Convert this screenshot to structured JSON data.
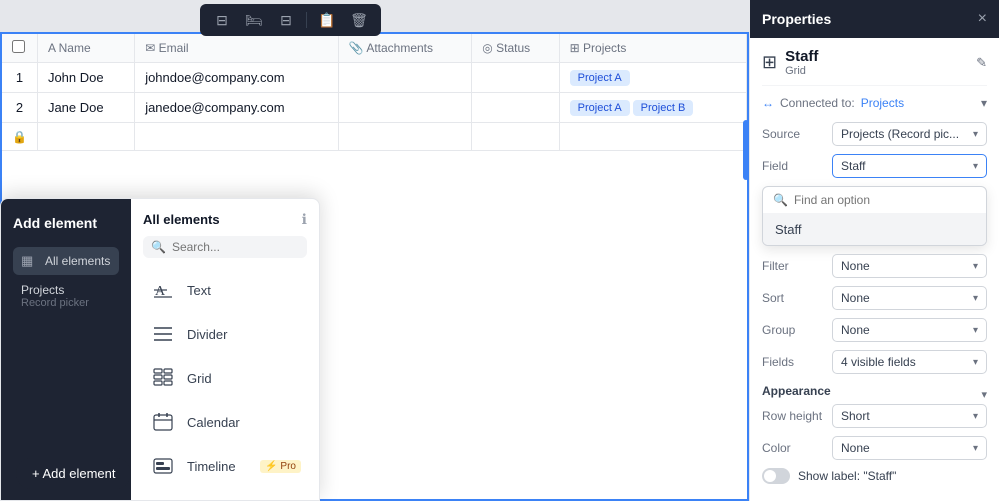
{
  "toolbar": {
    "icons": [
      "⊟",
      "⊞",
      "⊟",
      "📋",
      "🗑"
    ]
  },
  "table": {
    "columns": [
      {
        "label": "Name",
        "icon": "A"
      },
      {
        "label": "Email",
        "icon": "✉"
      },
      {
        "label": "Attachments",
        "icon": "📎"
      },
      {
        "label": "Status",
        "icon": "◎"
      },
      {
        "label": "Projects",
        "icon": "⊞"
      }
    ],
    "rows": [
      {
        "num": "1",
        "name": "John Doe",
        "email": "johndoe@company.com",
        "attachments": "",
        "status": "",
        "projects": [
          "Project A"
        ]
      },
      {
        "num": "2",
        "name": "Jane Doe",
        "email": "janedoe@company.com",
        "attachments": "",
        "status": "",
        "projects": [
          "Project A",
          "Project B"
        ]
      }
    ]
  },
  "add_element_panel": {
    "title": "Add element",
    "nav_items": [
      {
        "label": "All elements",
        "icon": "▦",
        "active": true
      },
      {
        "label": "Projects",
        "sub": "Record picker",
        "icon": "⟷",
        "active": false
      }
    ],
    "right_title": "All elements",
    "search_placeholder": "Search...",
    "elements": [
      {
        "label": "Text",
        "icon": "text"
      },
      {
        "label": "Divider",
        "icon": "divider"
      },
      {
        "label": "Grid",
        "icon": "grid"
      },
      {
        "label": "Calendar",
        "icon": "calendar"
      },
      {
        "label": "Timeline",
        "icon": "timeline",
        "pro": true
      }
    ]
  },
  "properties": {
    "title": "Properties",
    "close_label": "×",
    "grid_name": "Staff",
    "grid_type": "Grid",
    "edit_icon": "✎",
    "connected_label": "Connected to:",
    "connected_value": "Projects",
    "rows": [
      {
        "label": "Source",
        "value": "Projects (Record pic..."
      },
      {
        "label": "Field",
        "value": "Staff",
        "highlighted": true
      }
    ],
    "dropdown": {
      "search_placeholder": "Find an option",
      "items": [
        "Staff"
      ]
    },
    "more_rows": [
      {
        "label": "Filter",
        "value": "None"
      },
      {
        "label": "Sort",
        "value": "None"
      },
      {
        "label": "Group",
        "value": "None"
      },
      {
        "label": "Fields",
        "value": "4 visible fields"
      }
    ],
    "appearance_title": "Appearance",
    "appearance_rows": [
      {
        "label": "Row height",
        "value": "Short"
      },
      {
        "label": "Color",
        "value": "None"
      }
    ],
    "show_label": "Show label: \"Staff\""
  },
  "add_button_label": "+ Add element"
}
